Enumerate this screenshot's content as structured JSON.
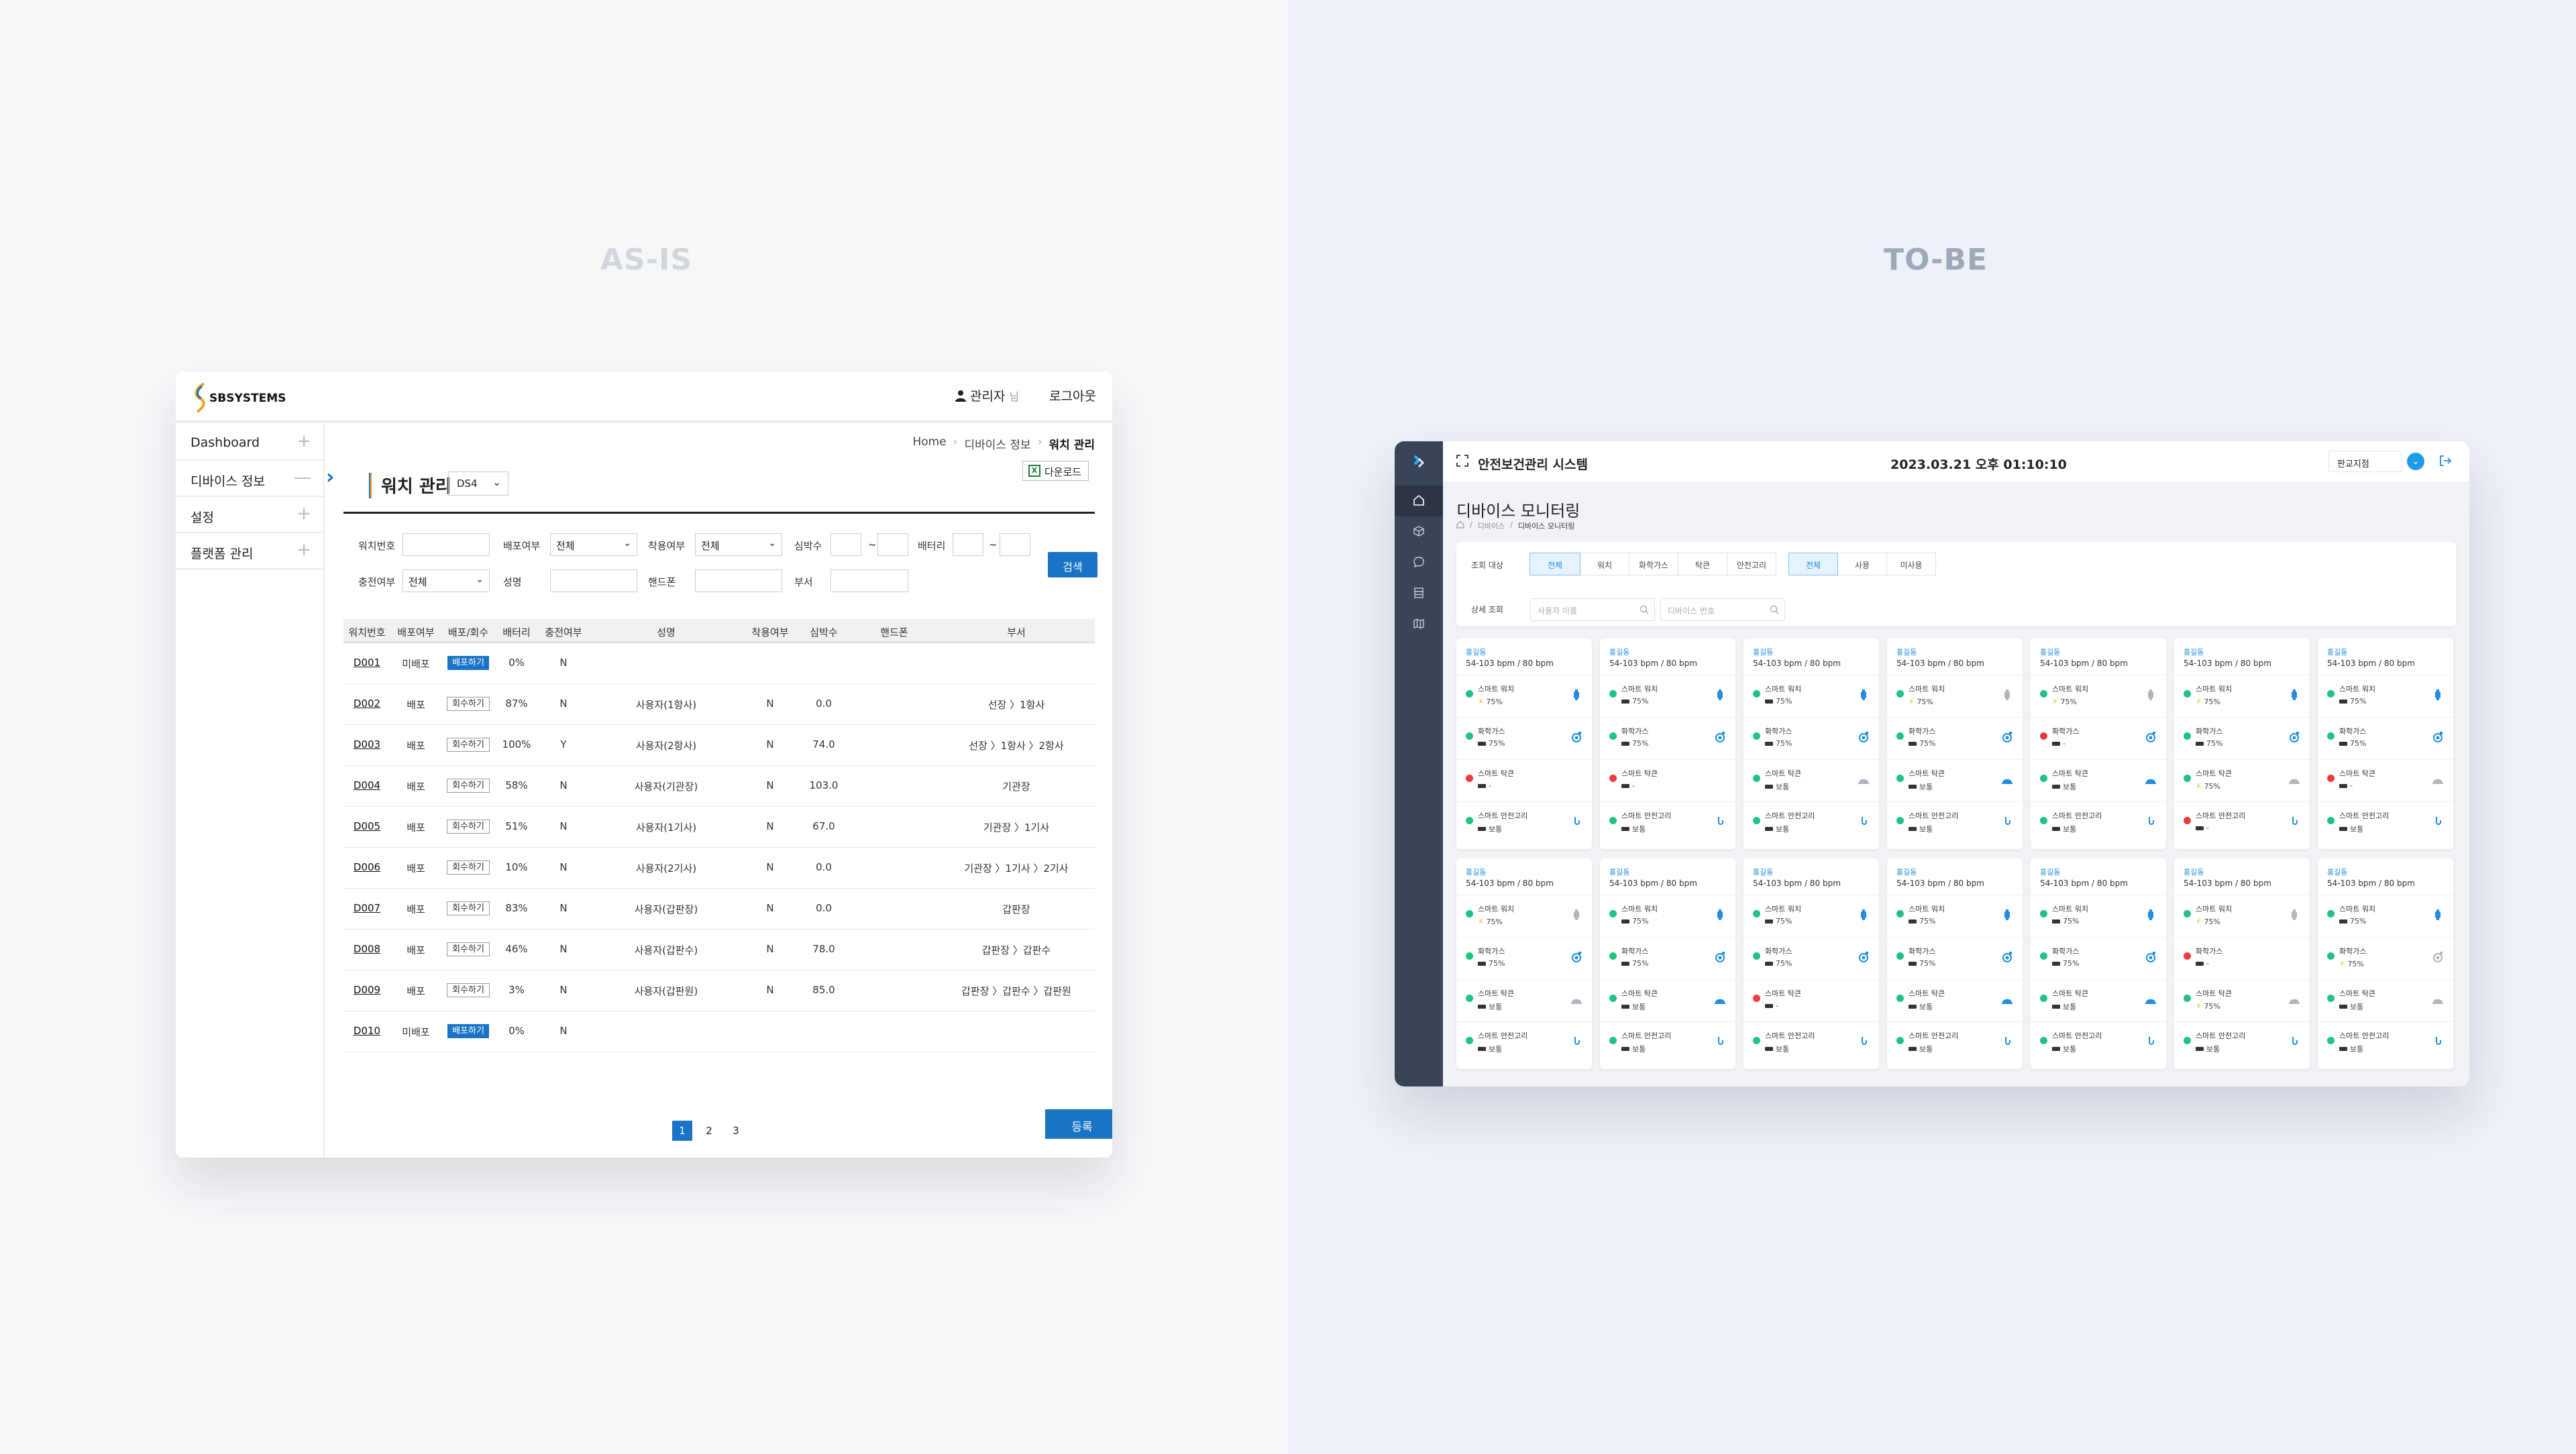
{
  "labels": {
    "asis": "AS-IS",
    "tobe": "TO-BE"
  },
  "asis": {
    "logo_text": "SBSYSTEMS",
    "user": "관리자",
    "user_suffix": "님",
    "logout": "로그아웃",
    "sidebar": [
      "Dashboard",
      "디바이스 정보",
      "설정",
      "플랫폼 관리"
    ],
    "sidebar_toggle": [
      "+",
      "—",
      "+",
      "+"
    ],
    "breadcrumb": [
      "Home",
      "디바이스 정보",
      "워치 관리"
    ],
    "page_title": "워치 관리",
    "model_select": "DS4",
    "download": "다운로드",
    "filters": {
      "watch_no": "워치번호",
      "deploy": "배포여부",
      "deploy_value": "전체",
      "wear": "착용여부",
      "wear_value": "전체",
      "heartrate": "심박수",
      "battery": "배터리",
      "charging": "충전여부",
      "charging_value": "전체",
      "name": "성명",
      "phone": "핸드폰",
      "dept": "부서",
      "tilde": "~",
      "search": "검색"
    },
    "table_headers": [
      "워치번호",
      "배포여부",
      "배포/회수",
      "배터리",
      "충전여부",
      "성명",
      "착용여부",
      "심박수",
      "핸드폰",
      "부서"
    ],
    "rows": [
      {
        "id": "D001",
        "deploy": "미배포",
        "action": "배포하기",
        "action_type": "deploy",
        "battery": "0%",
        "charging": "N",
        "name": "",
        "wear": "",
        "hr": "",
        "phone": "",
        "dept": ""
      },
      {
        "id": "D002",
        "deploy": "배포",
        "action": "회수하기",
        "action_type": "return",
        "battery": "87%",
        "charging": "N",
        "name": "사용자(1항사)",
        "wear": "N",
        "hr": "0.0",
        "phone": "",
        "dept": "선장 〉1항사"
      },
      {
        "id": "D003",
        "deploy": "배포",
        "action": "회수하기",
        "action_type": "return",
        "battery": "100%",
        "charging": "Y",
        "name": "사용자(2항사)",
        "wear": "N",
        "hr": "74.0",
        "phone": "",
        "dept": "선장 〉1항사 〉2항사"
      },
      {
        "id": "D004",
        "deploy": "배포",
        "action": "회수하기",
        "action_type": "return",
        "battery": "58%",
        "charging": "N",
        "name": "사용자(기관장)",
        "wear": "N",
        "hr": "103.0",
        "phone": "",
        "dept": "기관장"
      },
      {
        "id": "D005",
        "deploy": "배포",
        "action": "회수하기",
        "action_type": "return",
        "battery": "51%",
        "charging": "N",
        "name": "사용자(1기사)",
        "wear": "N",
        "hr": "67.0",
        "phone": "",
        "dept": "기관장 〉1기사"
      },
      {
        "id": "D006",
        "deploy": "배포",
        "action": "회수하기",
        "action_type": "return",
        "battery": "10%",
        "charging": "N",
        "name": "사용자(2기사)",
        "wear": "N",
        "hr": "0.0",
        "phone": "",
        "dept": "기관장 〉1기사 〉2기사"
      },
      {
        "id": "D007",
        "deploy": "배포",
        "action": "회수하기",
        "action_type": "return",
        "battery": "83%",
        "charging": "N",
        "name": "사용자(갑판장)",
        "wear": "N",
        "hr": "0.0",
        "phone": "",
        "dept": "갑판장"
      },
      {
        "id": "D008",
        "deploy": "배포",
        "action": "회수하기",
        "action_type": "return",
        "battery": "46%",
        "charging": "N",
        "name": "사용자(갑판수)",
        "wear": "N",
        "hr": "78.0",
        "phone": "",
        "dept": "갑판장 〉갑판수"
      },
      {
        "id": "D009",
        "deploy": "배포",
        "action": "회수하기",
        "action_type": "return",
        "battery": "3%",
        "charging": "N",
        "name": "사용자(갑판원)",
        "wear": "N",
        "hr": "85.0",
        "phone": "",
        "dept": "갑판장 〉갑판수 〉갑판원"
      },
      {
        "id": "D010",
        "deploy": "미배포",
        "action": "배포하기",
        "action_type": "deploy",
        "battery": "0%",
        "charging": "N",
        "name": "",
        "wear": "",
        "hr": "",
        "phone": "",
        "dept": ""
      }
    ],
    "pages": [
      "1",
      "2",
      "3"
    ],
    "register": "등록"
  },
  "tobe": {
    "app_title": "안전보건관리 시스템",
    "datetime": "2023.03.21 오후 01:10:10",
    "site_select": "판교지점",
    "page_title": "디바이스 모니터링",
    "breadcrumb": [
      "디바이스",
      "디바이스 모니터링"
    ],
    "filter_target_label": "조회 대상",
    "target_tabs": [
      "전체",
      "워치",
      "화학가스",
      "탁큰",
      "안전고리"
    ],
    "status_tabs": [
      "전체",
      "사용",
      "미사용"
    ],
    "detail_label": "상세 조회",
    "user_placeholder": "사용자 이름",
    "device_placeholder": "디바이스 번호",
    "card_name": "홍길동",
    "card_hr": "54-103 bpm / 80 bpm",
    "device_names": [
      "스마트 워치",
      "화학가스",
      "스마트 탁큰",
      "스마트 안전고리"
    ],
    "val_percent": "75%",
    "val_normal": "보통",
    "val_none": "-",
    "cards": [
      {
        "row": 0,
        "devs": [
          [
            "g",
            "75%",
            "blue",
            "bolt"
          ],
          [
            "g",
            "75%",
            "blue",
            ""
          ],
          [
            "r",
            "-",
            "",
            ""
          ],
          [
            "g",
            "보통",
            "blue",
            ""
          ]
        ]
      },
      {
        "row": 0,
        "devs": [
          [
            "g",
            "75%",
            "blue",
            ""
          ],
          [
            "g",
            "75%",
            "blue",
            ""
          ],
          [
            "r",
            "-",
            "",
            ""
          ],
          [
            "g",
            "보통",
            "blue",
            ""
          ]
        ]
      },
      {
        "row": 0,
        "devs": [
          [
            "g",
            "75%",
            "blue",
            ""
          ],
          [
            "g",
            "75%",
            "blue",
            ""
          ],
          [
            "g",
            "보통",
            "grey",
            ""
          ],
          [
            "g",
            "보통",
            "blue",
            ""
          ]
        ]
      },
      {
        "row": 0,
        "devs": [
          [
            "g",
            "75%",
            "grey",
            "bolt"
          ],
          [
            "g",
            "75%",
            "blue",
            ""
          ],
          [
            "g",
            "보통",
            "blue",
            ""
          ],
          [
            "g",
            "보통",
            "blue",
            ""
          ]
        ]
      },
      {
        "row": 0,
        "devs": [
          [
            "g",
            "75%",
            "grey",
            "bolt"
          ],
          [
            "r",
            "-",
            "blue",
            ""
          ],
          [
            "g",
            "보통",
            "blue",
            ""
          ],
          [
            "g",
            "보통",
            "blue",
            ""
          ]
        ]
      },
      {
        "row": 0,
        "devs": [
          [
            "g",
            "75%",
            "blue",
            "bolt"
          ],
          [
            "g",
            "75%",
            "blue",
            ""
          ],
          [
            "g",
            "75%",
            "grey",
            "bolt"
          ],
          [
            "r",
            "-",
            "blue",
            ""
          ]
        ]
      },
      {
        "row": 0,
        "devs": [
          [
            "g",
            "75%",
            "blue",
            ""
          ],
          [
            "g",
            "75%",
            "blue",
            ""
          ],
          [
            "r",
            "-",
            "grey",
            ""
          ],
          [
            "g",
            "보통",
            "blue",
            ""
          ]
        ]
      },
      {
        "row": 1,
        "devs": [
          [
            "g",
            "75%",
            "grey",
            "bolt"
          ],
          [
            "g",
            "75%",
            "blue",
            ""
          ],
          [
            "g",
            "보통",
            "grey",
            ""
          ],
          [
            "g",
            "보통",
            "blue",
            ""
          ]
        ]
      },
      {
        "row": 1,
        "devs": [
          [
            "g",
            "75%",
            "blue",
            ""
          ],
          [
            "g",
            "75%",
            "blue",
            ""
          ],
          [
            "g",
            "보통",
            "blue",
            ""
          ],
          [
            "g",
            "보통",
            "blue",
            ""
          ]
        ]
      },
      {
        "row": 1,
        "devs": [
          [
            "g",
            "75%",
            "blue",
            ""
          ],
          [
            "g",
            "75%",
            "blue",
            ""
          ],
          [
            "r",
            "-",
            "",
            ""
          ],
          [
            "g",
            "보통",
            "blue",
            ""
          ]
        ]
      },
      {
        "row": 1,
        "devs": [
          [
            "g",
            "75%",
            "blue",
            ""
          ],
          [
            "g",
            "75%",
            "blue",
            ""
          ],
          [
            "g",
            "보통",
            "blue",
            ""
          ],
          [
            "g",
            "보통",
            "blue",
            ""
          ]
        ]
      },
      {
        "row": 1,
        "devs": [
          [
            "g",
            "75%",
            "blue",
            ""
          ],
          [
            "g",
            "75%",
            "blue",
            ""
          ],
          [
            "g",
            "보통",
            "blue",
            ""
          ],
          [
            "g",
            "보통",
            "blue",
            ""
          ]
        ]
      },
      {
        "row": 1,
        "devs": [
          [
            "g",
            "75%",
            "grey",
            "bolt"
          ],
          [
            "r",
            "-",
            "",
            ""
          ],
          [
            "g",
            "75%",
            "grey",
            "bolt"
          ],
          [
            "g",
            "보통",
            "blue",
            ""
          ]
        ]
      },
      {
        "row": 1,
        "devs": [
          [
            "g",
            "75%",
            "blue",
            ""
          ],
          [
            "g",
            "75%",
            "grey",
            "bolt"
          ],
          [
            "g",
            "보통",
            "grey",
            ""
          ],
          [
            "g",
            "보통",
            "blue",
            ""
          ]
        ]
      }
    ],
    "colors": {
      "green": "#1fc481",
      "red": "#ef3b3b",
      "blue": "#1e8ee0",
      "grey": "#b0b6c0"
    }
  }
}
